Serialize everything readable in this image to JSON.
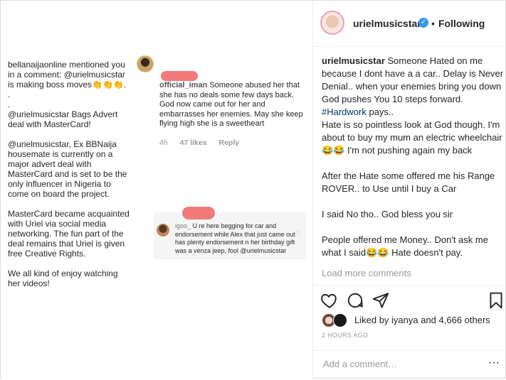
{
  "left": {
    "notification": "bellanaijaonline mentioned you in a comment: @urielmusicstar is making boss moves👏👏👏.\n.\n.\n@urielmusicstar Bags Advert deal with MasterCard!\n\n@urielmusicstar, Ex BBNaija housemate is currently on a major advert deal with MasterCard and is set to be the only influencer in Nigeria to come on board the project.\n\nMasterCard became acquainted with Uriel via social media networking. The fun part of the  deal remains that Uriel is given free Creative Rights.\n\nWe all kind of enjoy watching her videos!",
    "comment1": {
      "user": "official_iman",
      "text": "Someone abused her that she has no deals some few days back. God now came out for her and embarrasses her enemies. May she keep flying high she is a sweetheart",
      "time": "4h",
      "likes": "47 likes",
      "reply": "Reply"
    },
    "comment2": {
      "lead": "igoo_",
      "text": "U re here begging for car and endorsement while Alex that just came out has plenty endorsement n her birthday gift was a venza jeep, fool @urielmusicstar"
    }
  },
  "post": {
    "username": "urielmusicstar",
    "verified_glyph": "✓",
    "separator": "•",
    "follow_status": "Following",
    "caption_user": "urielmusicstar",
    "caption_a": "Someone Hated on me because I dont have a a car.. Delay is Never Denial.. when your enemies bring you down God pushes You 10 steps forward.\n",
    "caption_tag": "#Hardwork",
    "caption_b": " pays..\nHate is so pointless look at God though. I'm about to buy my mum an electric wheelchair 😂😂 I'm not pushing again my back\n\nAfter the Hate some offered me his Range ROVER.. to Use until I buy a Car\n\nI said No tho.. God bless you sir\n\nPeople offered me Money.. Don't ask me what I said😂😂 Hate doesn't pay.",
    "load_more": "Load more comments",
    "liked_by": "Liked by iyanya and 4,666 others",
    "timestamp": "2 HOURS AGO",
    "add_comment_placeholder": "Add a comment…",
    "more_glyph": "···"
  },
  "icons": {
    "like": "heart-icon",
    "comment": "comment-icon",
    "share": "share-icon",
    "save": "bookmark-icon"
  }
}
